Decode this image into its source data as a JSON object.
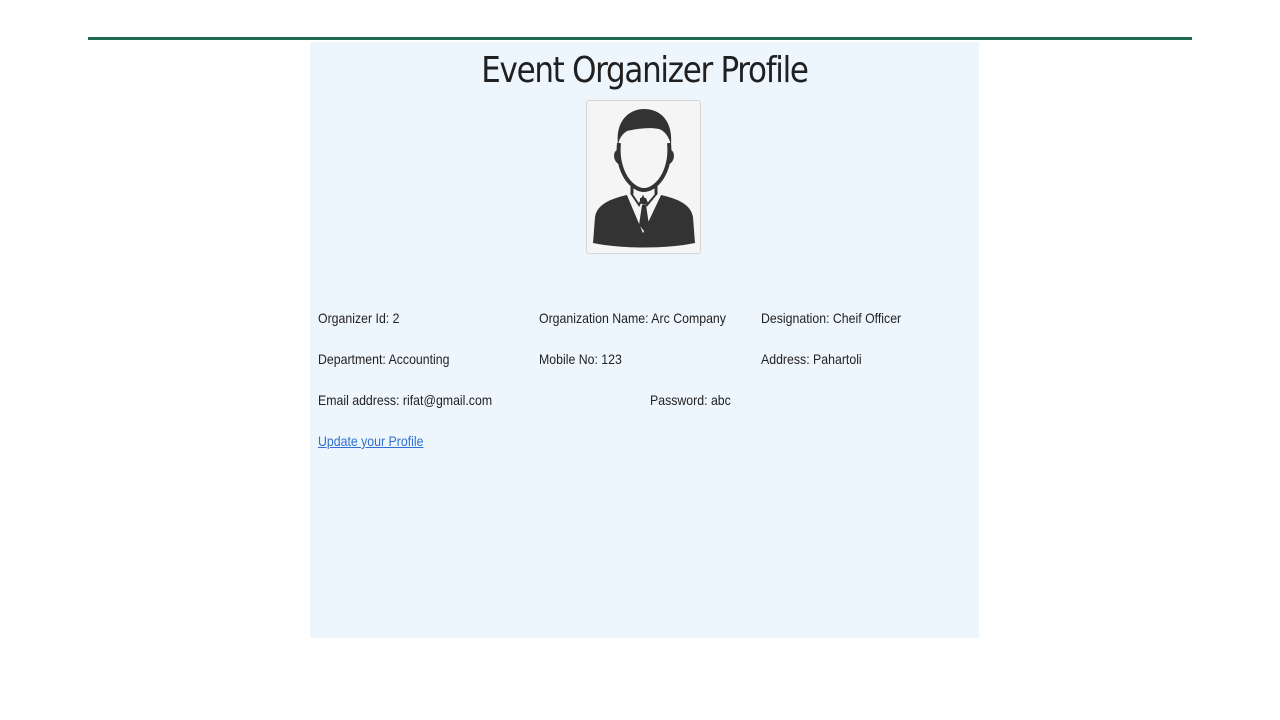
{
  "page": {
    "title": "Event Organizer Profile",
    "accent_color": "#1d6b52",
    "panel_color": "#eef6fd",
    "link_color": "#2f6fd0"
  },
  "avatar": {
    "icon": "businessman-avatar-icon"
  },
  "profile": {
    "organizer_id": "Organizer Id: 2",
    "organization_name": "Organization Name: Arc Company",
    "designation": "Designation: Cheif Officer",
    "department": "Department: Accounting",
    "mobile": "Mobile No: 123",
    "address": "Address: Pahartoli",
    "email": "Email address: rifat@gmail.com",
    "password": "Password: abc"
  },
  "actions": {
    "update_profile_label": "Update your Profile"
  }
}
